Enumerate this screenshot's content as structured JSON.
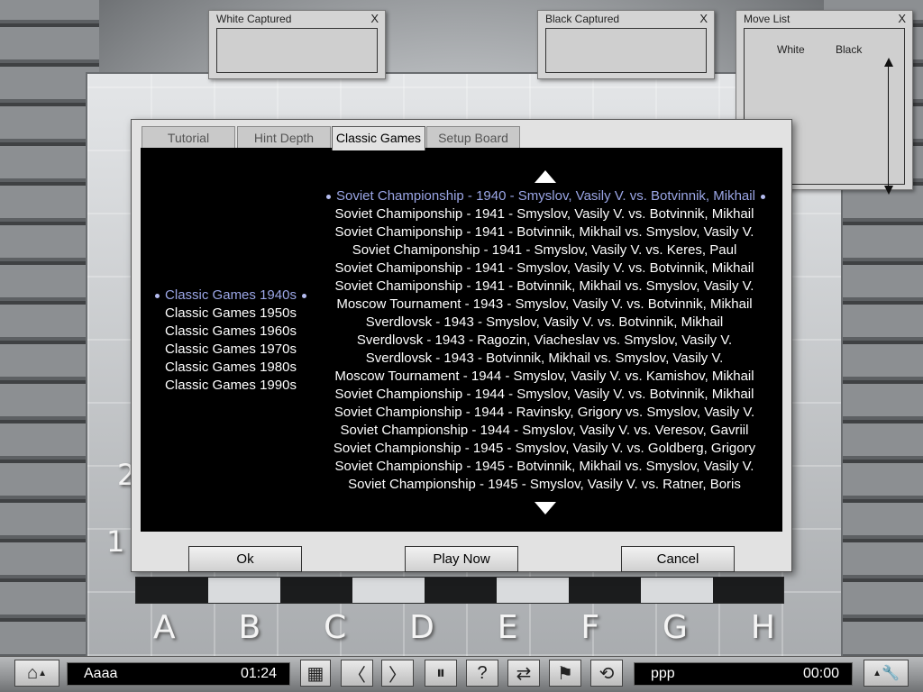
{
  "board": {
    "files": [
      "A",
      "B",
      "C",
      "D",
      "E",
      "F",
      "G",
      "H"
    ],
    "rank_2": "2",
    "rank_1": "1"
  },
  "panels": {
    "white_captured": {
      "title": "White Captured",
      "close": "X"
    },
    "black_captured": {
      "title": "Black Captured",
      "close": "X"
    },
    "move_list": {
      "title": "Move List",
      "close": "X",
      "col_white": "White",
      "col_black": "Black"
    }
  },
  "dialog": {
    "tabs": [
      {
        "label": "Tutorial",
        "active": false
      },
      {
        "label": "Hint Depth",
        "active": false
      },
      {
        "label": "Classic Games",
        "active": true
      },
      {
        "label": "Setup Board",
        "active": false
      }
    ],
    "decades": [
      {
        "label": "Classic Games 1940s",
        "selected": true
      },
      {
        "label": "Classic Games 1950s",
        "selected": false
      },
      {
        "label": "Classic Games 1960s",
        "selected": false
      },
      {
        "label": "Classic Games 1970s",
        "selected": false
      },
      {
        "label": "Classic Games 1980s",
        "selected": false
      },
      {
        "label": "Classic Games 1990s",
        "selected": false
      }
    ],
    "games": [
      {
        "label": "Soviet Championship - 1940 - Smyslov, Vasily V. vs. Botvinnik, Mikhail",
        "selected": true
      },
      {
        "label": "Soviet Chamiponship - 1941 - Smyslov, Vasily V. vs. Botvinnik, Mikhail",
        "selected": false
      },
      {
        "label": "Soviet Chamiponship - 1941 - Botvinnik, Mikhail vs. Smyslov, Vasily V.",
        "selected": false
      },
      {
        "label": "Soviet Chamiponship - 1941 - Smyslov, Vasily V. vs. Keres, Paul",
        "selected": false
      },
      {
        "label": "Soviet Chamiponship - 1941 - Smyslov, Vasily V. vs. Botvinnik, Mikhail",
        "selected": false
      },
      {
        "label": "Soviet Chamiponship - 1941 - Botvinnik, Mikhail vs. Smyslov, Vasily V.",
        "selected": false
      },
      {
        "label": "Moscow Tournament - 1943 - Smyslov, Vasily V. vs. Botvinnik, Mikhail",
        "selected": false
      },
      {
        "label": "Sverdlovsk - 1943 - Smyslov, Vasily V. vs. Botvinnik, Mikhail",
        "selected": false
      },
      {
        "label": "Sverdlovsk - 1943 - Ragozin, Viacheslav vs. Smyslov, Vasily V.",
        "selected": false
      },
      {
        "label": "Sverdlovsk - 1943 - Botvinnik, Mikhail vs. Smyslov, Vasily V.",
        "selected": false
      },
      {
        "label": "Moscow Tournament - 1944 - Smyslov, Vasily V. vs. Kamishov, Mikhail",
        "selected": false
      },
      {
        "label": "Soviet Championship - 1944 - Smyslov, Vasily V. vs. Botvinnik, Mikhail",
        "selected": false
      },
      {
        "label": "Soviet Championship - 1944 - Ravinsky, Grigory vs. Smyslov, Vasily V.",
        "selected": false
      },
      {
        "label": "Soviet Championship - 1944 - Smyslov, Vasily V. vs. Veresov, Gavriil",
        "selected": false
      },
      {
        "label": "Soviet Championship - 1945 - Smyslov, Vasily V. vs. Goldberg, Grigory",
        "selected": false
      },
      {
        "label": "Soviet Championship - 1945 - Botvinnik, Mikhail vs. Smyslov, Vasily V.",
        "selected": false
      },
      {
        "label": "Soviet Championship - 1945 - Smyslov, Vasily V. vs. Ratner, Boris",
        "selected": false
      }
    ],
    "buttons": {
      "ok": "Ok",
      "play_now": "Play Now",
      "cancel": "Cancel"
    }
  },
  "toolbar": {
    "player1": {
      "name": "Aaaa",
      "time": "01:24"
    },
    "player2": {
      "name": "ppp",
      "time": "00:00"
    },
    "icons": {
      "home": "⌂",
      "board": "▦",
      "back": "〈",
      "forward": "〉",
      "pause": "⏸",
      "hint": "?",
      "swap": "⇄",
      "flag": "⚑",
      "rotate": "⟲",
      "settings": "🔧"
    }
  },
  "colors": {
    "selected_item": "#9ba6e6",
    "list_background": "#000000",
    "dialog_background": "#e2e2e2"
  }
}
